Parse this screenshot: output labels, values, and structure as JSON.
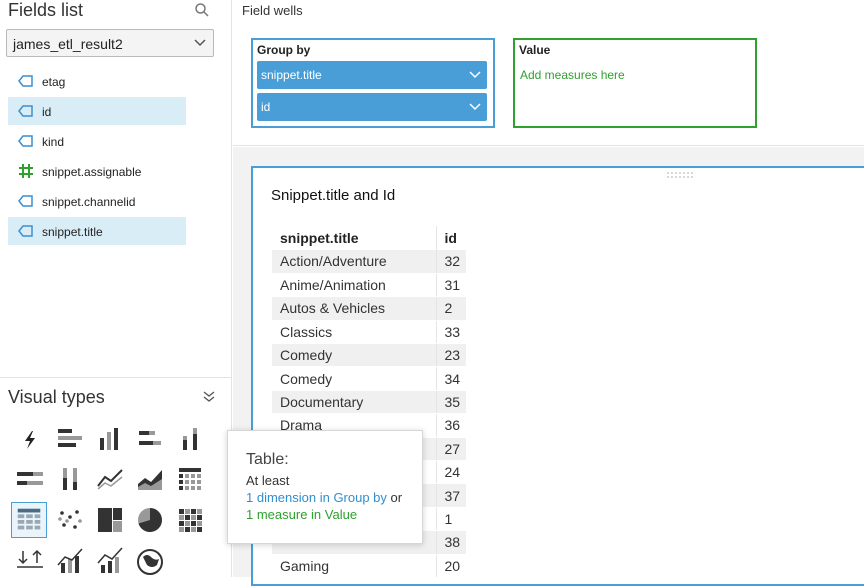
{
  "fields_panel": {
    "title": "Fields list",
    "dataset": "james_etl_result2",
    "fields": [
      {
        "name": "etag",
        "type": "dimension",
        "selected": false
      },
      {
        "name": "id",
        "type": "dimension",
        "selected": true
      },
      {
        "name": "kind",
        "type": "dimension",
        "selected": false
      },
      {
        "name": "snippet.assignable",
        "type": "measure",
        "selected": false
      },
      {
        "name": "snippet.channelid",
        "type": "dimension",
        "selected": false
      },
      {
        "name": "snippet.title",
        "type": "dimension",
        "selected": true
      }
    ]
  },
  "visual_types": {
    "title": "Visual types",
    "items": [
      "autograph",
      "horizontal-bar",
      "vertical-bar",
      "horizontal-stacked-bar",
      "vertical-stacked-bar",
      "horizontal-100-bar",
      "vertical-100-bar",
      "line",
      "area",
      "pivot-table",
      "table",
      "scatter",
      "tree-map",
      "pie",
      "heat-map",
      "kpi",
      "combo-bar-line",
      "combo-stacked-line",
      "geospatial"
    ],
    "selected": "table"
  },
  "field_wells": {
    "title": "Field wells",
    "group_by": {
      "label": "Group by",
      "items": [
        "snippet.title",
        "id"
      ]
    },
    "value": {
      "label": "Value",
      "placeholder": "Add measures here"
    }
  },
  "visual": {
    "title": "Snippet.title and Id",
    "columns": [
      "snippet.title",
      "id"
    ],
    "rows": [
      [
        "Action/Adventure",
        "32"
      ],
      [
        "Anime/Animation",
        "31"
      ],
      [
        "Autos & Vehicles",
        "2"
      ],
      [
        "Classics",
        "33"
      ],
      [
        "Comedy",
        "23"
      ],
      [
        "Comedy",
        "34"
      ],
      [
        "Documentary",
        "35"
      ],
      [
        "Drama",
        "36"
      ],
      [
        "",
        "27"
      ],
      [
        "",
        "24"
      ],
      [
        "",
        "37"
      ],
      [
        "",
        "1"
      ],
      [
        "",
        "38"
      ],
      [
        "Gaming",
        "20"
      ]
    ]
  },
  "tooltip": {
    "title": "Table:",
    "line1": "At least",
    "line2_link": "1 dimension in Group by",
    "line2_suffix": " or",
    "line3_link": "1 measure in Value"
  },
  "colors": {
    "accent": "#4a9ed8",
    "measure_green": "#2ea12e",
    "selected_bg": "#d9edf7"
  }
}
